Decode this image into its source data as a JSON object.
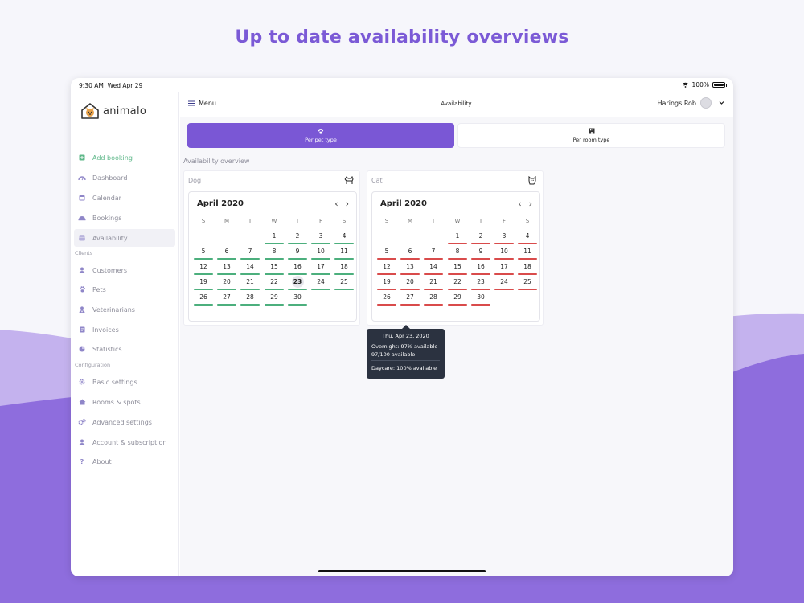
{
  "headline": "Up to date availability overviews",
  "status_bar": {
    "time": "9:30 AM",
    "date": "Wed Apr 29",
    "battery": "100%",
    "icons": [
      "wifi-icon",
      "battery-icon"
    ]
  },
  "brand": {
    "name": "animalo",
    "logo": "dog-house-logo-icon"
  },
  "sidebar": {
    "add_booking": {
      "label": "Add booking",
      "icon": "plus-square-icon"
    },
    "main_items": [
      {
        "label": "Dashboard",
        "icon": "speedometer-icon"
      },
      {
        "label": "Calendar",
        "icon": "calendar-icon"
      },
      {
        "label": "Bookings",
        "icon": "cloche-icon"
      },
      {
        "label": "Availability",
        "icon": "grid-calendar-icon"
      }
    ],
    "clients_label": "Clients",
    "client_items": [
      {
        "label": "Customers",
        "icon": "user-icon"
      },
      {
        "label": "Pets",
        "icon": "paw-icon"
      },
      {
        "label": "Veterinarians",
        "icon": "user-md-icon"
      },
      {
        "label": "Invoices",
        "icon": "invoice-icon"
      },
      {
        "label": "Statistics",
        "icon": "chart-icon"
      }
    ],
    "configuration_label": "Configuration",
    "config_items": [
      {
        "label": "Basic settings",
        "icon": "gear-icon"
      },
      {
        "label": "Rooms & spots",
        "icon": "house-icon"
      },
      {
        "label": "Advanced settings",
        "icon": "gears-icon"
      },
      {
        "label": "Account & subscription",
        "icon": "user-icon"
      },
      {
        "label": "About",
        "icon": "question-icon"
      }
    ]
  },
  "topbar": {
    "menu_label": "Menu",
    "page_title": "Availability",
    "user_name": "Harings Rob"
  },
  "tabs": [
    {
      "label": "Per pet type",
      "icon": "paw-icon",
      "active": true
    },
    {
      "label": "Per room type",
      "icon": "building-icon",
      "active": false
    }
  ],
  "overview_label": "Availability overview",
  "weekdays": [
    "S",
    "M",
    "T",
    "W",
    "T",
    "F",
    "S"
  ],
  "calendars": [
    {
      "pet": "Dog",
      "icon": "dog-icon",
      "month": "April 2020",
      "status_color": "#4caf7d",
      "selected_day": 23
    },
    {
      "pet": "Cat",
      "icon": "cat-icon",
      "month": "April 2020",
      "status_color": "#d94b4b"
    }
  ],
  "days": [
    "1",
    "2",
    "3",
    "4",
    "5",
    "6",
    "7",
    "8",
    "9",
    "10",
    "11",
    "12",
    "13",
    "14",
    "15",
    "16",
    "17",
    "18",
    "19",
    "20",
    "21",
    "22",
    "23",
    "24",
    "25",
    "26",
    "27",
    "28",
    "29",
    "30"
  ],
  "tooltip": {
    "title": "Thu, Apr 23, 2020",
    "overnight": "Overnight: 97% available",
    "count": "97/100 available",
    "daycare": "Daycare: 100% available"
  },
  "colors": {
    "accent": "#7a57d5",
    "available": "#4caf7d",
    "unavailable": "#d94b4b"
  }
}
